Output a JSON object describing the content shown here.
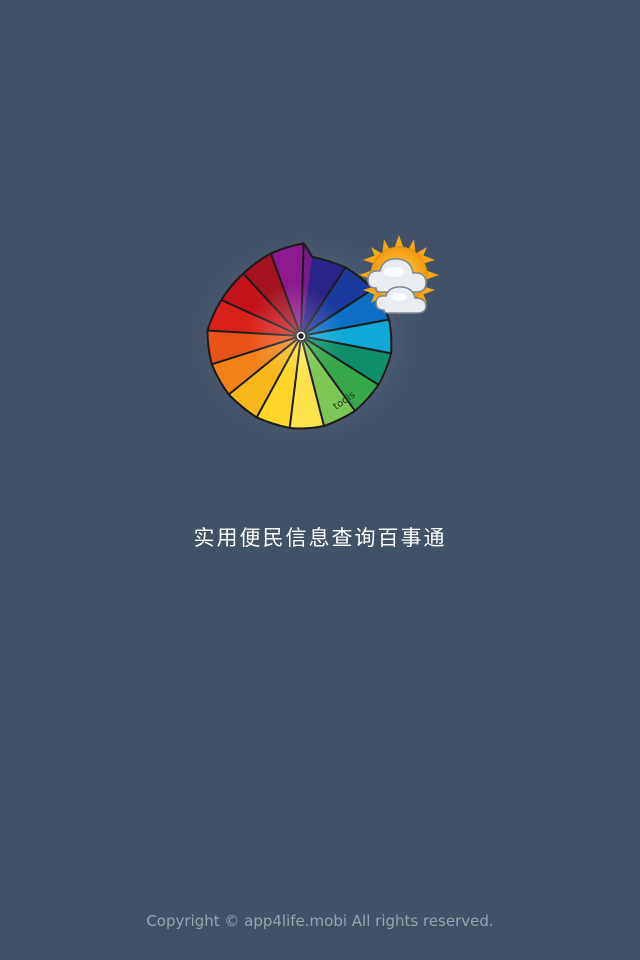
{
  "splash": {
    "tagline": "实用便民信息查询百事通",
    "copyright": "Copyright © app4life.mobi All rights reserved.",
    "logo_label": "tools"
  },
  "colors": {
    "background": "#415167",
    "tagline": "#ffffff",
    "copyright": "#9aa3ae"
  },
  "icons": [
    "umbrella-logo-icon",
    "sun-icon",
    "cloud-icon"
  ]
}
